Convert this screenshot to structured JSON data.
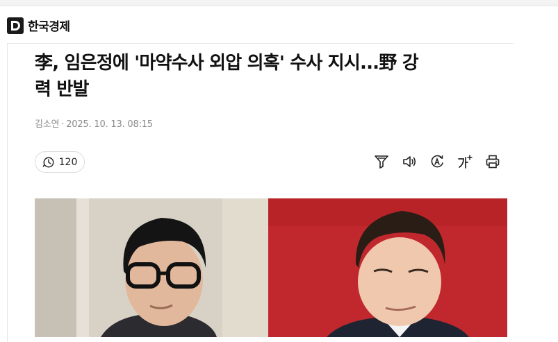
{
  "brand": {
    "name": "한국경제",
    "logo_letter": "D"
  },
  "article": {
    "title_line1": "李, 임은정에 '마약수사 외압 의혹' 수사 지시...野 강",
    "title_line2": "력 반발",
    "author": "김소연",
    "separator": "·",
    "datetime": "2025. 10. 13. 08:15",
    "view_count": "120"
  },
  "toolbar": {
    "icons": [
      "filter-icon",
      "speaker-icon",
      "translate-icon",
      "font-size-icon",
      "print-icon"
    ]
  },
  "colors": {
    "photo_right_bg": "#c0282d",
    "photo_left_bg": "#d8d2c6"
  }
}
